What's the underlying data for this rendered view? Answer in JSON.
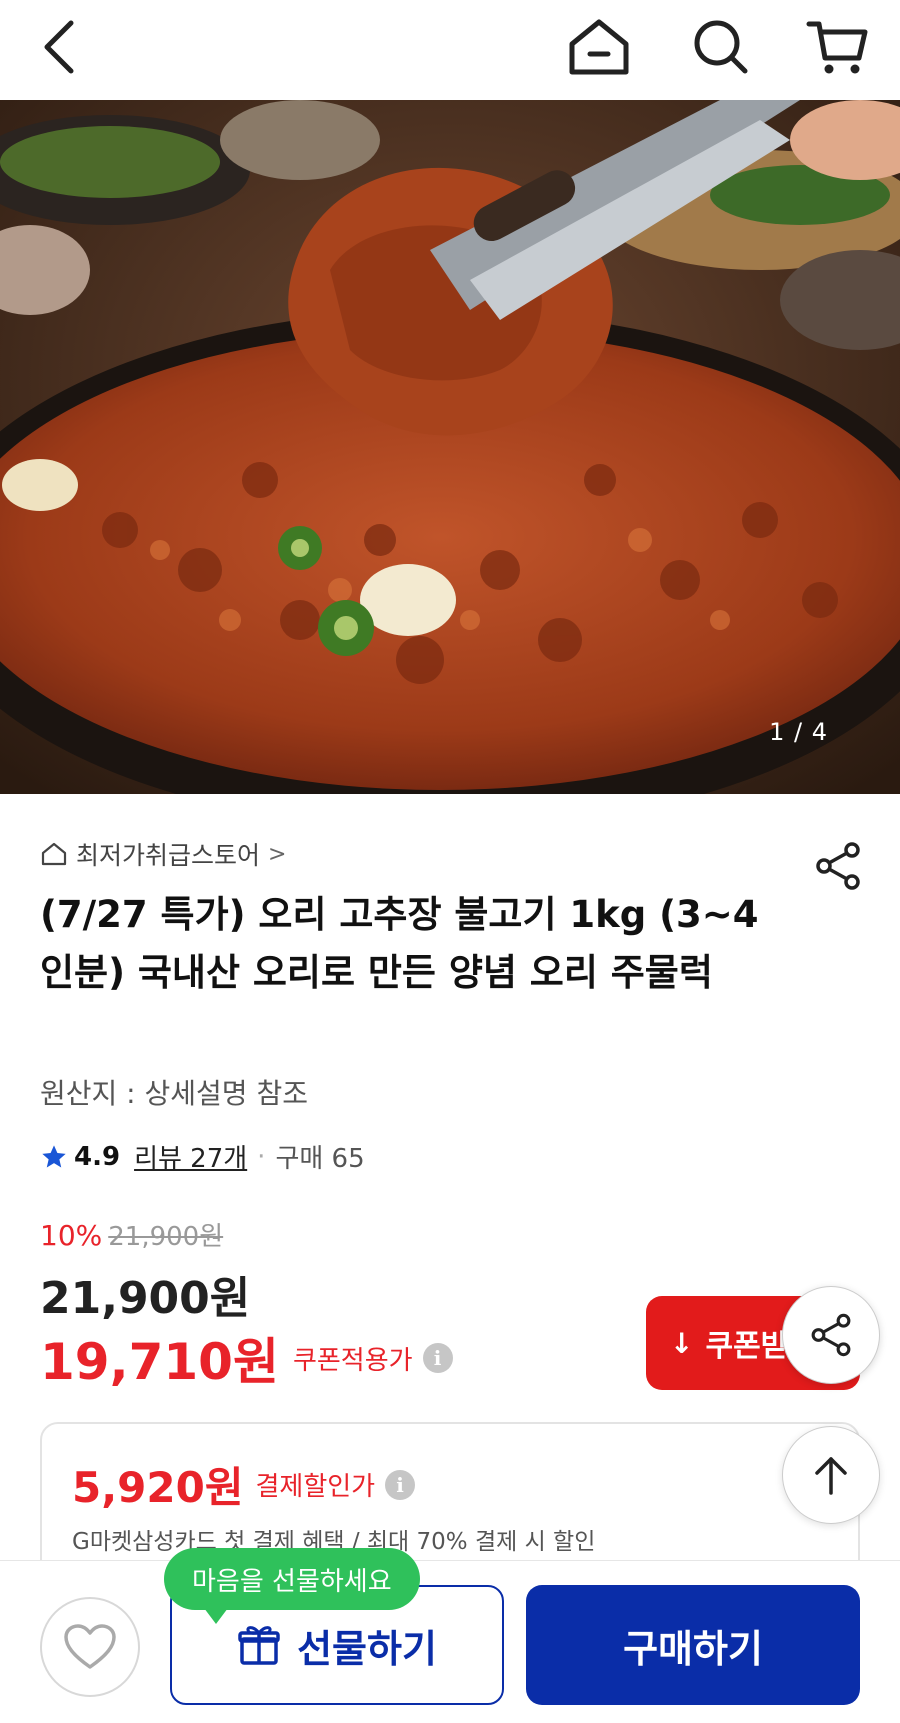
{
  "topbar": {
    "back_icon": "chevron-left-icon",
    "home_icon": "home-icon",
    "search_icon": "search-icon",
    "cart_icon": "cart-icon"
  },
  "hero": {
    "pager": "1 / 4"
  },
  "store": {
    "name": "최저가취급스토어",
    "chevron": ">"
  },
  "product": {
    "title": "(7/27 특가) 오리 고추장 불고기 1kg (3~4인분) 국내산 오리로 만든 양념 오리 주물럭",
    "origin": "원산지 : 상세설명 참조",
    "rating": "4.9",
    "review": "리뷰 27개",
    "dot": "·",
    "sold": "구매 65"
  },
  "pricing": {
    "discount_pct": "10%",
    "original_price": "21,900원",
    "price": "21,900원",
    "coupon_price": "19,710원",
    "coupon_label": "쿠폰적용가",
    "info_glyph": "i",
    "coupon_button": "쿠폰받",
    "coupon_button_icon": "↓"
  },
  "payment": {
    "price": "5,920원",
    "label": "결제할인가",
    "info_glyph": "i",
    "sub": "G마켓삼성카드 첫 결제 혜택 / 최대 70% 결제 시 할인"
  },
  "bottom": {
    "gift_bubble": "마음을 선물하세요",
    "gift_button": "선물하기",
    "buy_button": "구매하기"
  },
  "colors": {
    "accent_red": "#e21b1b",
    "brand_blue": "#0a2da8",
    "bubble_green": "#2fc15b"
  }
}
